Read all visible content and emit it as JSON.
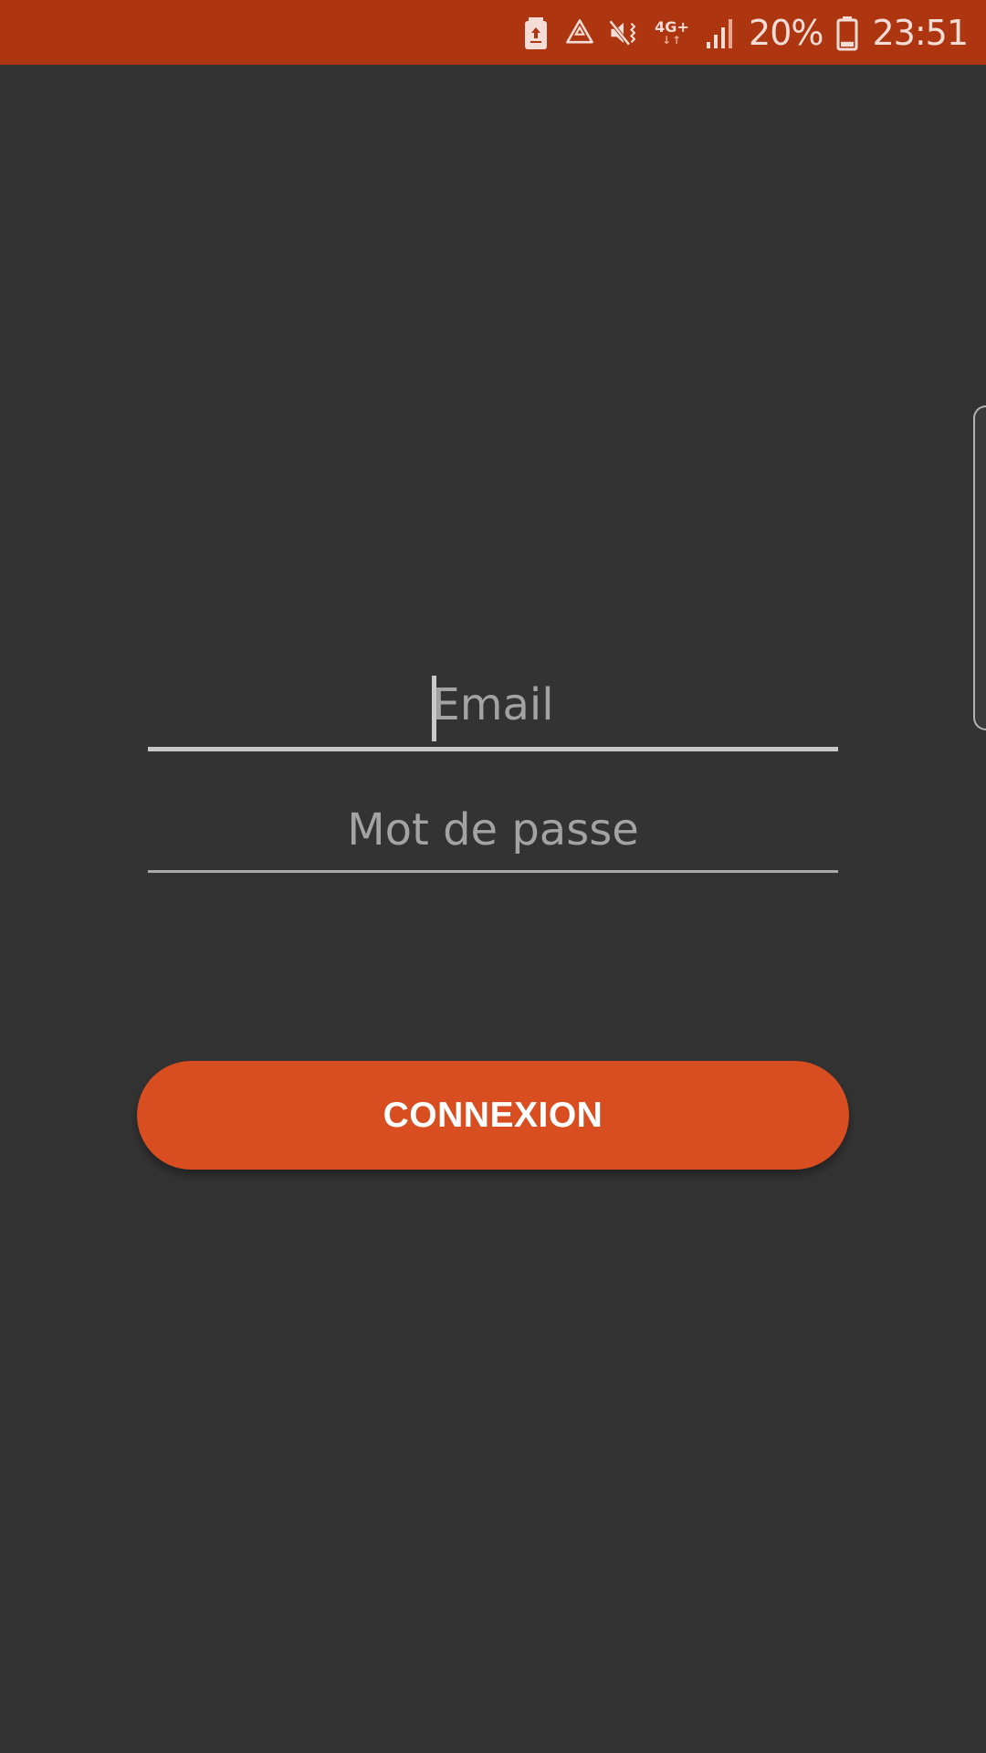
{
  "status_bar": {
    "color": "#ad3510",
    "icons": [
      "battery-saver-icon",
      "recycle-icon",
      "mute-vibrate-icon",
      "network-type-icon",
      "signal-strength-icon",
      "battery-icon"
    ],
    "network_type": "4G+",
    "network_arrows": "↓↑",
    "battery_percent": "20%",
    "battery_level": 0.2,
    "time": "23:51"
  },
  "login_form": {
    "email": {
      "value": "",
      "placeholder": "Email"
    },
    "password": {
      "value": "",
      "placeholder": "Mot de passe"
    },
    "submit_label": "CONNEXION",
    "accent_color": "#d84e20"
  },
  "background_color": "#333333"
}
